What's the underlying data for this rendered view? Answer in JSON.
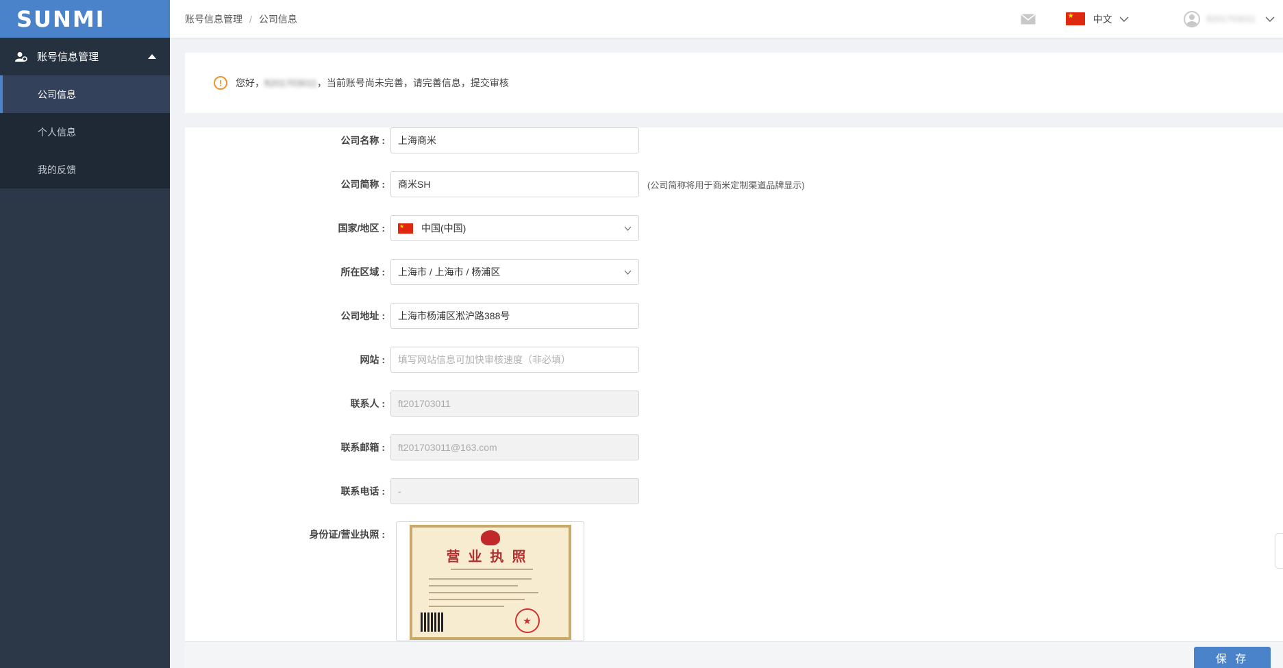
{
  "app": {
    "logo_text": "SUNMI"
  },
  "sidebar": {
    "group_label": "账号信息管理",
    "items": [
      {
        "label": "公司信息",
        "active": true
      },
      {
        "label": "个人信息",
        "active": false
      },
      {
        "label": "我的反馈",
        "active": false
      }
    ]
  },
  "header": {
    "breadcrumb": [
      "账号信息管理",
      "公司信息"
    ],
    "breadcrumb_sep": "/",
    "language": "中文",
    "user_name": "ft201703011",
    "icons": {
      "mail": "mail-icon",
      "flag": "china-flag-icon",
      "user": "user-avatar-icon"
    }
  },
  "notice": {
    "greeting": "您好，",
    "user": "ft201703011",
    "message": "，当前账号尚未完善，请完善信息，提交审核"
  },
  "form": {
    "company_name": {
      "label": "公司名称 :",
      "value": "上海商米"
    },
    "company_short": {
      "label": "公司简称 :",
      "value": "商米SH",
      "hint": "(公司简称将用于商米定制渠道品牌显示)"
    },
    "country": {
      "label": "国家/地区 :",
      "value": "中国(中国)"
    },
    "region": {
      "label": "所在区域 :",
      "value": "上海市 / 上海市 / 杨浦区"
    },
    "address": {
      "label": "公司地址 :",
      "value": "上海市杨浦区淞沪路388号"
    },
    "website": {
      "label": "网站 :",
      "placeholder": "填写网站信息可加快审核速度（非必填）"
    },
    "contact": {
      "label": "联系人 :",
      "value": "ft201703011"
    },
    "email": {
      "label": "联系邮箱 :",
      "value": "ft201703011@163.com"
    },
    "phone": {
      "label": "联系电话 :",
      "value": "-"
    },
    "license": {
      "label": "身份证/营业执照 :",
      "doc_title": "营业执照"
    }
  },
  "footer": {
    "save_label": "保 存"
  },
  "colors": {
    "brand": "#4a83c9",
    "sidebar_bg": "#2c3848",
    "warning": "#f0932b"
  }
}
